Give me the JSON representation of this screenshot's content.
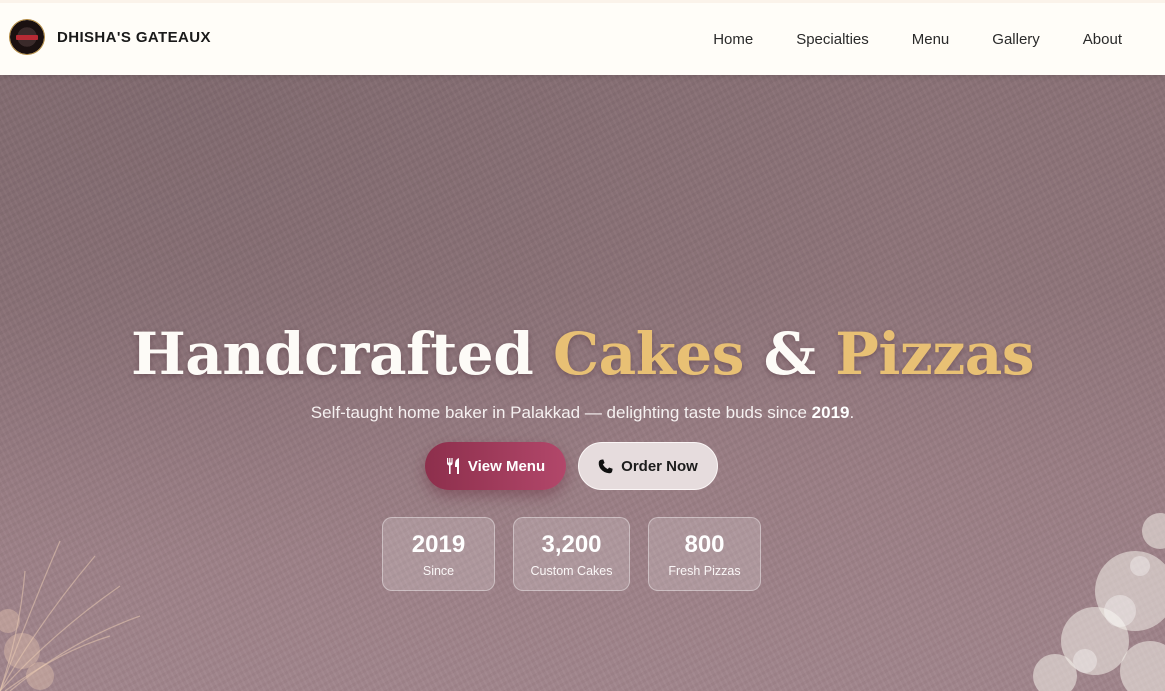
{
  "brand": {
    "name": "DHISHA'S GATEAUX",
    "logo_icon": "bakery-logo-icon"
  },
  "nav": {
    "items": [
      "Home",
      "Specialties",
      "Menu",
      "Gallery",
      "About"
    ]
  },
  "hero": {
    "title_part1": "Handcrafted",
    "title_highlight1": "Cakes",
    "title_amp": "&",
    "title_highlight2": "Pizzas",
    "subtitle_text": "Self-taught home baker in Palakkad — delighting taste buds since",
    "subtitle_year": "2019",
    "subtitle_end": ".",
    "buttons": [
      {
        "label": "View Menu",
        "icon": "utensils-icon"
      },
      {
        "label": "Order Now",
        "icon": "phone-icon"
      }
    ],
    "stats": [
      {
        "value": "2019",
        "label": "Since"
      },
      {
        "value": "3,200",
        "label": "Custom Cakes"
      },
      {
        "value": "800",
        "label": "Fresh Pizzas"
      }
    ]
  },
  "colors": {
    "accent_gold": "#e8c074",
    "primary_button": "#a03e5c",
    "nav_background": "#fffdf8",
    "hero_overlay": "#8c7378"
  }
}
